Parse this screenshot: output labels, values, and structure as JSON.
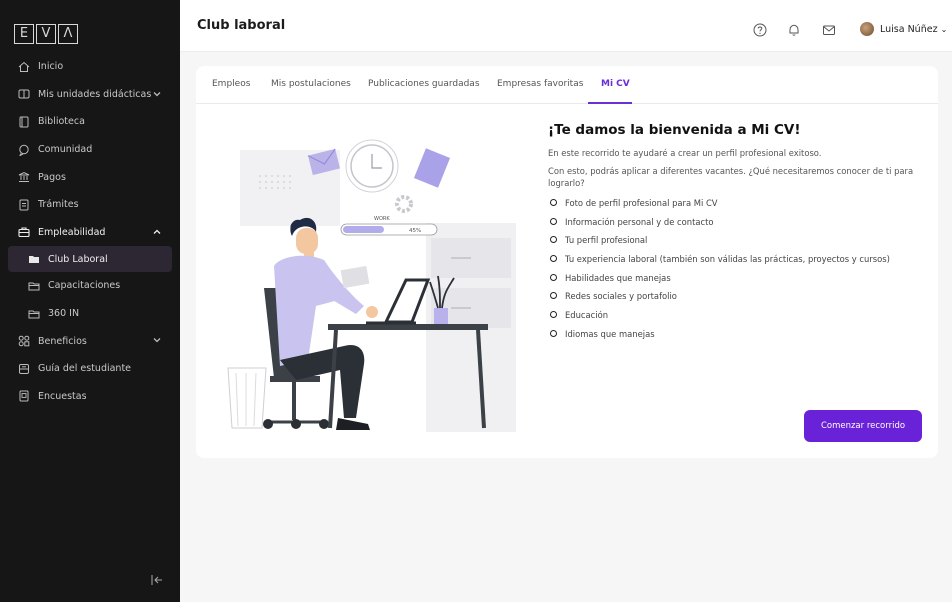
{
  "sidebar": {
    "logo_letters": [
      "E",
      "V",
      "Λ"
    ],
    "items": [
      {
        "label": "Inicio",
        "icon": "home-icon"
      },
      {
        "label": "Mis unidades didácticas",
        "icon": "book-open-icon",
        "chevron": "down"
      },
      {
        "label": "Biblioteca",
        "icon": "book-icon"
      },
      {
        "label": "Comunidad",
        "icon": "chat-icon"
      },
      {
        "label": "Pagos",
        "icon": "bank-icon"
      },
      {
        "label": "Trámites",
        "icon": "document-icon"
      },
      {
        "label": "Empleabilidad",
        "icon": "briefcase-icon",
        "chevron": "up"
      },
      {
        "label": "Club Laboral",
        "icon": "folder-icon",
        "active": true
      },
      {
        "label": "Capacitaciones",
        "icon": "folder-outline-icon"
      },
      {
        "label": "360 IN",
        "icon": "folder-outline-icon"
      },
      {
        "label": "Beneficios",
        "icon": "grid-icon",
        "chevron": "down"
      },
      {
        "label": "Guía del estudiante",
        "icon": "guide-icon"
      },
      {
        "label": "Encuestas",
        "icon": "survey-icon"
      }
    ]
  },
  "header": {
    "title": "Club laboral",
    "user_name": "Luisa Núñez",
    "icons": [
      "help-icon",
      "bell-icon",
      "mail-icon"
    ]
  },
  "tabs": [
    {
      "label": "Empleos"
    },
    {
      "label": "Mis postulaciones"
    },
    {
      "label": "Publicaciones guardadas"
    },
    {
      "label": "Empresas favoritas"
    },
    {
      "label": "Mi CV",
      "active": true
    }
  ],
  "illustration": {
    "work_label": "WORK",
    "progress_label": "45%",
    "progress": 0.45
  },
  "content": {
    "title": "¡Te damos la bienvenida a Mi CV!",
    "intro_1": "En este recorrido te ayudaré a crear un perfil profesional exitoso.",
    "intro_2": "Con esto, podrás aplicar a diferentes vacantes. ¿Qué necesitaremos conocer de ti para lograrlo?",
    "items": [
      "Foto de perfil profesional para Mi CV",
      "Información personal y de contacto",
      "Tu perfil profesional",
      "Tu experiencia laboral (también son válidas las prácticas, proyectos y cursos)",
      "Habilidades que manejas",
      "Redes sociales y portafolio",
      "Educación",
      "Idiomas que manejas"
    ],
    "cta_label": "Comenzar recorrido"
  },
  "colors": {
    "accent": "#6a22d8",
    "sidebar_bg": "#161616",
    "active_item_bg": "#2d2733"
  }
}
